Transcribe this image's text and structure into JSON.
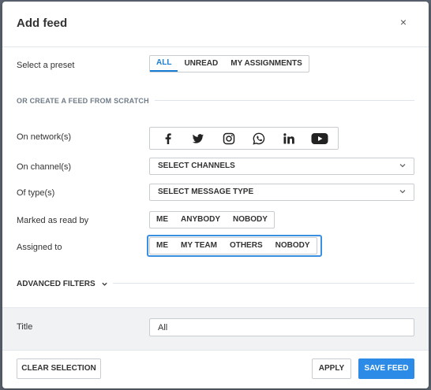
{
  "dialog": {
    "title": "Add feed",
    "close_label": "×"
  },
  "preset": {
    "label": "Select a preset",
    "options": [
      "ALL",
      "UNREAD",
      "MY ASSIGNMENTS"
    ],
    "active": "ALL"
  },
  "scratch_section": {
    "title": "OR CREATE A FEED FROM SCRATCH"
  },
  "network": {
    "label": "On network(s)",
    "icons": [
      "facebook-icon",
      "twitter-icon",
      "instagram-icon",
      "whatsapp-icon",
      "linkedin-icon",
      "youtube-icon"
    ]
  },
  "channel": {
    "label": "On channel(s)",
    "value": "SELECT CHANNELS"
  },
  "type": {
    "label": "Of type(s)",
    "value": "SELECT MESSAGE TYPE"
  },
  "read_by": {
    "label": "Marked as read by",
    "options": [
      "ME",
      "ANYBODY",
      "NOBODY"
    ]
  },
  "assigned": {
    "label": "Assigned to",
    "options": [
      "ME",
      "MY TEAM",
      "OTHERS",
      "NOBODY"
    ]
  },
  "advanced": {
    "label": "ADVANCED FILTERS"
  },
  "title_field": {
    "label": "Title",
    "value": "All"
  },
  "footer": {
    "clear_label": "CLEAR SELECTION",
    "apply_label": "APPLY",
    "save_label": "SAVE FEED"
  },
  "colors": {
    "accent": "#2b8be6",
    "focus_outline": "#3b8fe0"
  }
}
